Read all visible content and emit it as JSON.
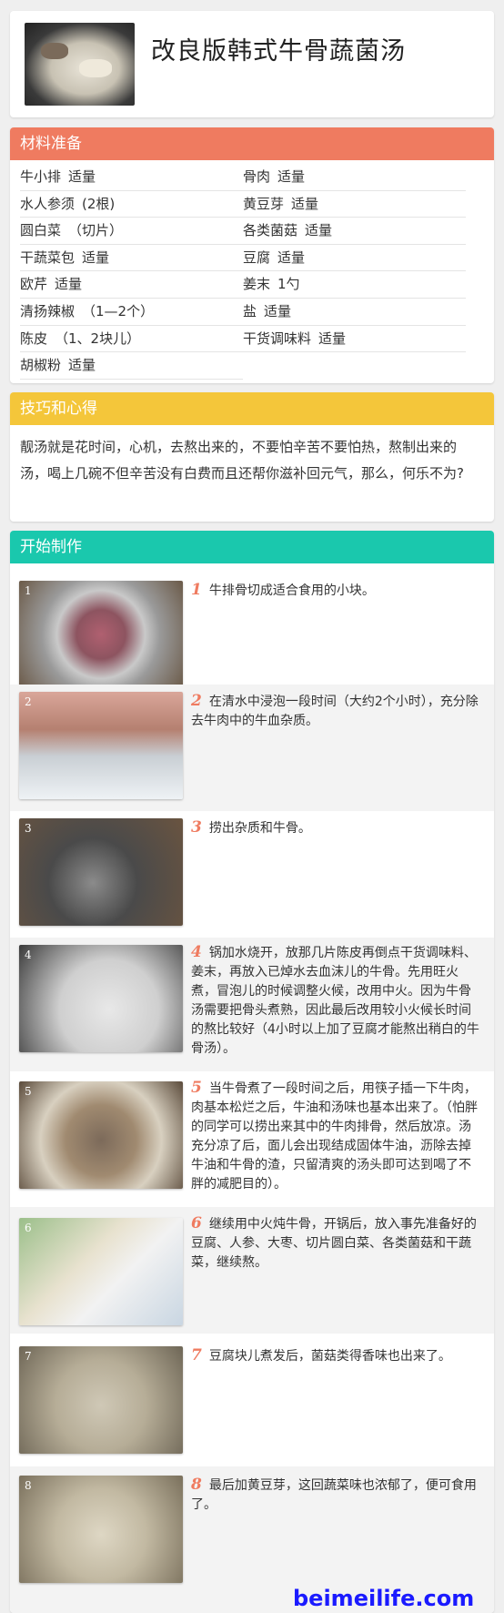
{
  "recipe": {
    "title": "改良版韩式牛骨蔬菌汤"
  },
  "ingredients": {
    "header": "材料准备",
    "items": [
      {
        "name": "牛小排",
        "amount": "适量"
      },
      {
        "name": "骨肉",
        "amount": "适量"
      },
      {
        "name": "水人参须",
        "amount": "(2根)"
      },
      {
        "name": "黄豆芽",
        "amount": "适量"
      },
      {
        "name": "圆白菜",
        "amount": "（切片）"
      },
      {
        "name": "各类菌菇",
        "amount": "适量"
      },
      {
        "name": "干蔬菜包",
        "amount": "适量"
      },
      {
        "name": "豆腐",
        "amount": "适量"
      },
      {
        "name": "欧芹",
        "amount": "适量"
      },
      {
        "name": "姜末",
        "amount": "1勺"
      },
      {
        "name": "清扬辣椒",
        "amount": "（1—2个）"
      },
      {
        "name": "盐",
        "amount": "适量"
      },
      {
        "name": "陈皮",
        "amount": "（1、2块儿）"
      },
      {
        "name": "干货调味料",
        "amount": "适量"
      },
      {
        "name": "胡椒粉",
        "amount": "适量"
      }
    ]
  },
  "tips": {
    "header": "技巧和心得",
    "text": "靓汤就是花时间，心机，去熬出来的，不要怕辛苦不要怕热，熬制出来的汤，喝上几碗不但辛苦没有白费而且还帮你滋补回元气，那么，何乐不为?"
  },
  "steps": {
    "header": "开始制作",
    "items": [
      {
        "num": "1",
        "photo_label": "1",
        "text": "牛排骨切成适合食用的小块。"
      },
      {
        "num": "2",
        "photo_label": "2",
        "text": "在清水中浸泡一段时间（大约2个小时），充分除去牛肉中的牛血杂质。"
      },
      {
        "num": "3",
        "photo_label": "3",
        "text": "捞出杂质和牛骨。"
      },
      {
        "num": "4",
        "photo_label": "4",
        "text": "锅加水烧开，放那几片陈皮再倒点干货调味料、姜末，再放入已焯水去血沫儿的牛骨。先用旺火煮，冒泡儿的时候调整火候，改用中火。因为牛骨汤需要把骨头煮熟，因此最后改用较小火候长时间的熬比较好（4小时以上加了豆腐才能熬出稍白的牛骨汤）。"
      },
      {
        "num": "5",
        "photo_label": "5",
        "text": "当牛骨煮了一段时间之后，用筷子插一下牛肉，肉基本松烂之后，牛油和汤味也基本出来了。（怕胖的同学可以捞出来其中的牛肉排骨，然后放凉。汤充分凉了后，面儿会出现结成固体牛油，沥除去掉牛油和牛骨的渣，只留清爽的汤头即可达到喝了不胖的减肥目的）。"
      },
      {
        "num": "6",
        "photo_label": "6",
        "text": "继续用中火炖牛骨，开锅后，放入事先准备好的豆腐、人参、大枣、切片圆白菜、各类菌菇和干蔬菜，继续熬。"
      },
      {
        "num": "7",
        "photo_label": "7",
        "text": "豆腐块儿煮发后，菌菇类得香味也出来了。"
      },
      {
        "num": "8",
        "photo_label": "8",
        "text": "最后加黄豆芽，这回蔬菜味也浓郁了，便可食用了。"
      }
    ]
  },
  "watermark": "beimeilife.com"
}
